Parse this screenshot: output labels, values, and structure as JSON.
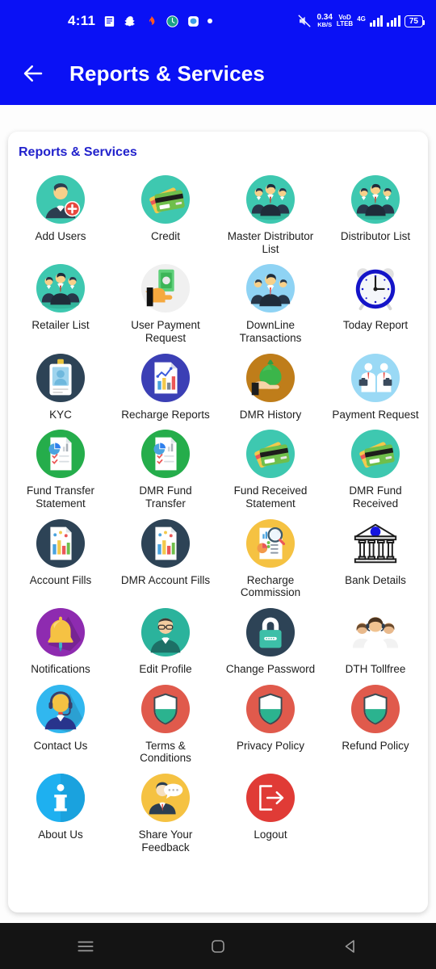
{
  "statusbar": {
    "time": "4:11",
    "icons": [
      "news-icon",
      "snapchat-icon",
      "flame-icon",
      "clock-badge-icon",
      "messenger-icon",
      "dot-icon"
    ],
    "net_speed_value": "0.34",
    "net_speed_unit": "KB/S",
    "volte_line1": "VoD",
    "volte_line2": "LTEB",
    "network_type": "4G",
    "battery": "75"
  },
  "appbar": {
    "back_icon": "arrow-left-icon",
    "title": "Reports & Services"
  },
  "card": {
    "section_title": "Reports & Services",
    "items": [
      {
        "label": "Add Users",
        "icon": "add-user-icon"
      },
      {
        "label": "Credit",
        "icon": "credit-card-icon"
      },
      {
        "label": "Master Distributor List",
        "icon": "people-group-icon"
      },
      {
        "label": "Distributor List",
        "icon": "people-group-icon"
      },
      {
        "label": "Retailer List",
        "icon": "people-group-icon"
      },
      {
        "label": "User Payment Request",
        "icon": "hand-cash-icon"
      },
      {
        "label": "DownLine Transactions",
        "icon": "people-blue-icon"
      },
      {
        "label": "Today Report",
        "icon": "alarm-clock-icon"
      },
      {
        "label": "KYC",
        "icon": "id-card-icon"
      },
      {
        "label": "Recharge Reports",
        "icon": "report-chart-icon"
      },
      {
        "label": "DMR History",
        "icon": "hand-money-bag-icon"
      },
      {
        "label": "Payment Request",
        "icon": "businessmen-icon"
      },
      {
        "label": "Fund Transfer Statement",
        "icon": "document-check-icon"
      },
      {
        "label": "DMR Fund Transfer",
        "icon": "document-check-icon"
      },
      {
        "label": "Fund Received Statement",
        "icon": "credit-card-icon"
      },
      {
        "label": "DMR Fund Received",
        "icon": "credit-card-icon"
      },
      {
        "label": "Account Fills",
        "icon": "bar-chart-doc-icon"
      },
      {
        "label": "DMR Account Fills",
        "icon": "bar-chart-doc-icon"
      },
      {
        "label": "Recharge Commission",
        "icon": "magnifier-report-icon"
      },
      {
        "label": "Bank Details",
        "icon": "bank-icon"
      },
      {
        "label": "Notifications",
        "icon": "bell-icon"
      },
      {
        "label": "Edit Profile",
        "icon": "profile-edit-icon"
      },
      {
        "label": "Change Password",
        "icon": "lock-icon"
      },
      {
        "label": "DTH Tollfree",
        "icon": "support-team-icon"
      },
      {
        "label": "Contact Us",
        "icon": "headset-agent-icon"
      },
      {
        "label": "Terms & Conditions",
        "icon": "shield-icon"
      },
      {
        "label": "Privacy Policy",
        "icon": "shield-icon"
      },
      {
        "label": "Refund Policy",
        "icon": "shield-icon"
      },
      {
        "label": "About Us",
        "icon": "info-icon"
      },
      {
        "label": "Share Your Feedback",
        "icon": "feedback-icon"
      },
      {
        "label": "Logout",
        "icon": "logout-icon"
      }
    ]
  },
  "navbar": {
    "recents_icon": "menu-icon",
    "home_icon": "home-square-icon",
    "back_icon": "back-triangle-icon"
  },
  "colors": {
    "brand_blue": "#0a11f5",
    "title_blue": "#2222cc",
    "teal": "#3ec8b0",
    "green": "#25ad4b",
    "dark_navy": "#2d4356",
    "purple": "#8e2bb0",
    "red": "#e05a4c",
    "orange": "#f5c242",
    "sky": "#29b6f6",
    "brown": "#bf7d1a",
    "indigo": "#3b3fb5"
  }
}
